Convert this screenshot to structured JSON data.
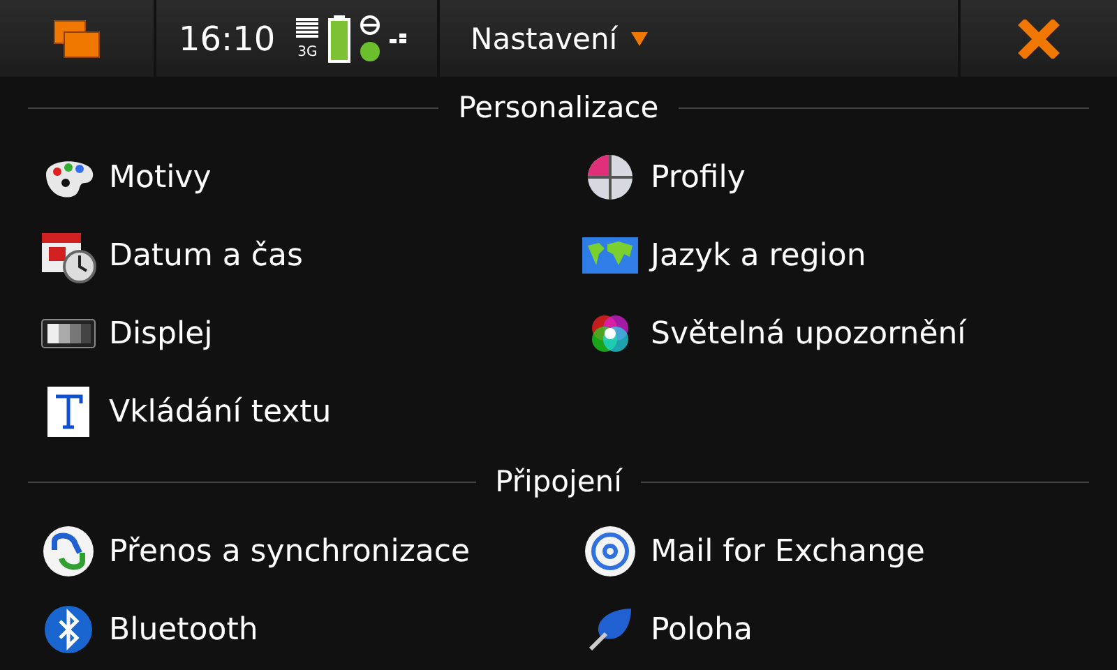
{
  "header": {
    "time": "16:10",
    "network": "3G",
    "title": "Nastavení"
  },
  "sections": [
    {
      "title": "Personalizace",
      "items": [
        {
          "label": "Motivy"
        },
        {
          "label": "Profily"
        },
        {
          "label": "Datum a čas"
        },
        {
          "label": "Jazyk a region"
        },
        {
          "label": "Displej"
        },
        {
          "label": "Světelná upozornění"
        },
        {
          "label": "Vkládání textu"
        }
      ]
    },
    {
      "title": "Připojení",
      "items": [
        {
          "label": "Přenos a synchronizace"
        },
        {
          "label": "Mail for Exchange"
        },
        {
          "label": "Bluetooth"
        },
        {
          "label": "Poloha"
        }
      ]
    }
  ]
}
